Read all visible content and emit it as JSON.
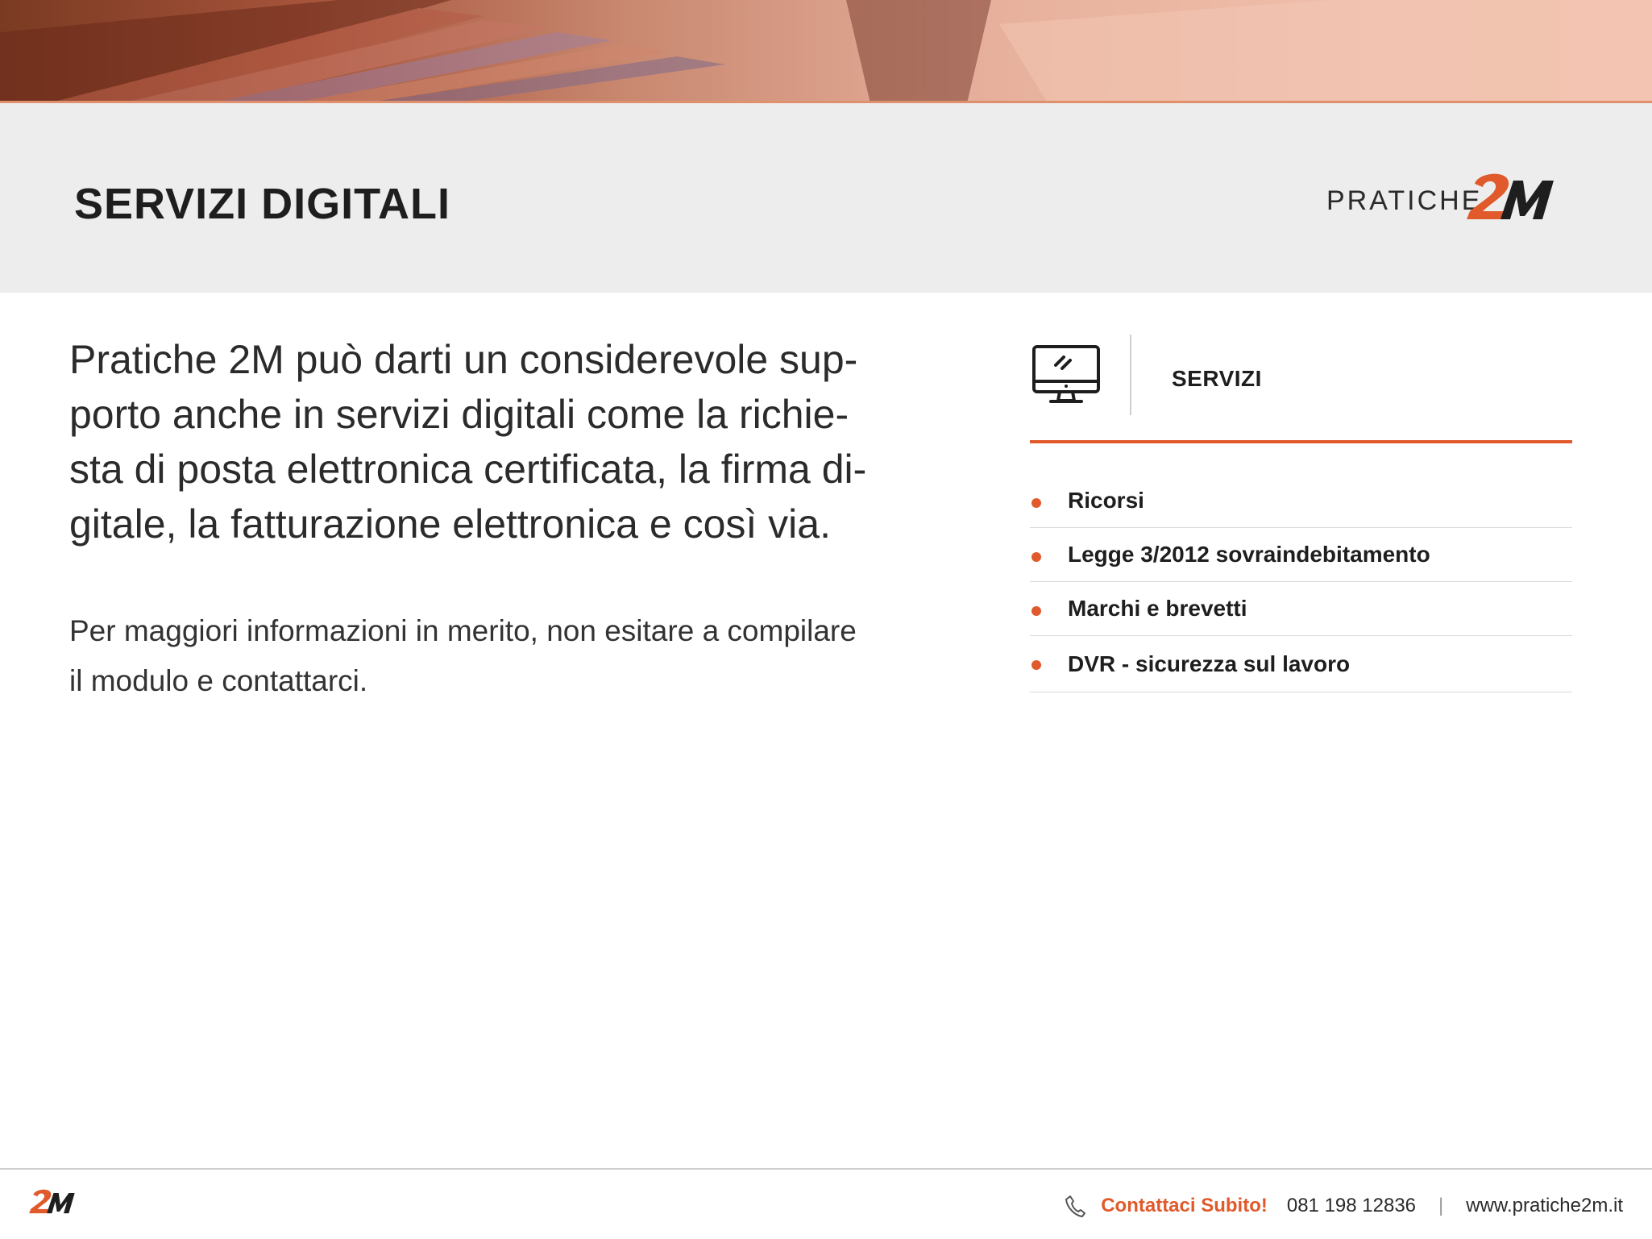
{
  "header": {
    "title": "SERVIZI DIGITALI",
    "brand_text": "PRATICHE",
    "brand_mark": "2M"
  },
  "main": {
    "lead_lines": [
      "Pratiche 2M può darti un considerevole sup-",
      "porto anche in servizi digitali come la richie-",
      "sta di posta elettronica certificata, la firma di-",
      "gitale, la fatturazione elettronica e così via."
    ],
    "info_lines": [
      "Per maggiori informazioni in merito, non esitare a compilare",
      "il modulo e contattarci."
    ]
  },
  "services": {
    "icon": "monitor-icon",
    "title": "SERVIZI",
    "items": [
      "Ricorsi",
      "Legge 3/2012 sovraindebitamento",
      "Marchi e brevetti",
      "DVR - sicurezza sul lavoro"
    ]
  },
  "footer": {
    "logo": "2M",
    "cta": "Contattaci Subito!",
    "phone": "081 198 12836",
    "separator": "|",
    "website": "www.pratiche2m.it"
  },
  "colors": {
    "accent": "#e05a2b",
    "title_band": "#ededed",
    "text": "#1e1e1e"
  }
}
